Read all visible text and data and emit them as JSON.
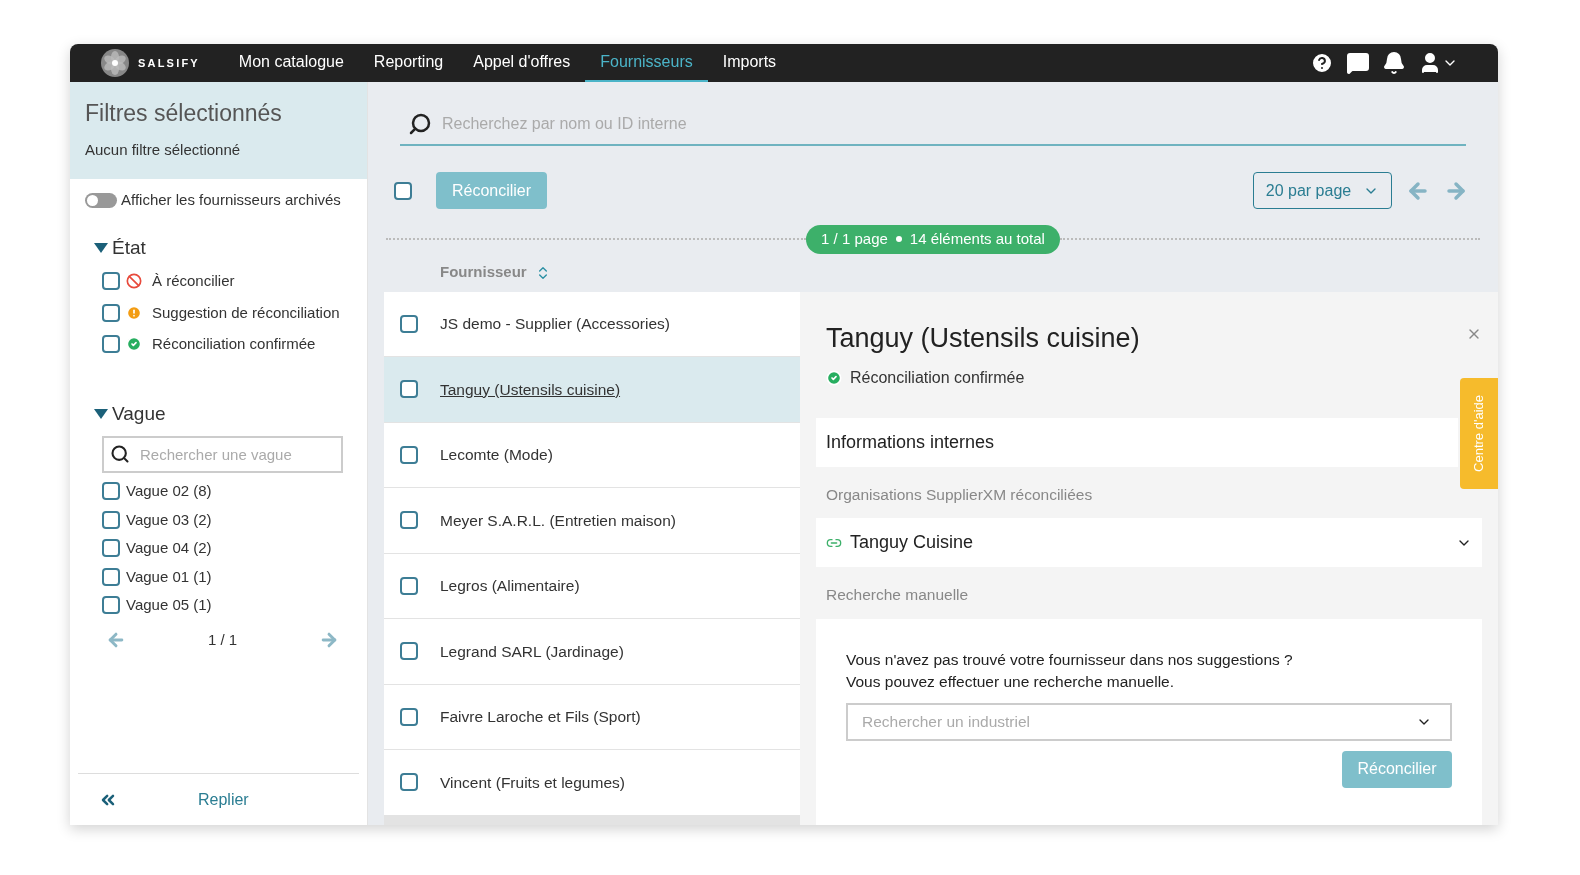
{
  "nav": {
    "logo": "SALSIFY",
    "items": [
      {
        "label": "Mon catalogue",
        "selected": false
      },
      {
        "label": "Reporting",
        "selected": false
      },
      {
        "label": "Appel d'offres",
        "selected": false
      },
      {
        "label": "Fournisseurs",
        "selected": true
      },
      {
        "label": "Imports",
        "selected": false
      }
    ]
  },
  "sidebar": {
    "title": "Filtres sélectionnés",
    "subtitle": "Aucun filtre sélectionné",
    "archived_toggle": {
      "label": "Afficher les fournisseurs archivés",
      "on": false
    },
    "etat": {
      "title": "État",
      "expanded": true,
      "items": [
        {
          "label": "À réconcilier",
          "checked": false,
          "kind": "blocked"
        },
        {
          "label": "Suggestion de réconciliation",
          "checked": false,
          "kind": "warning"
        },
        {
          "label": "Réconciliation confirmée",
          "checked": false,
          "kind": "confirmed"
        }
      ]
    },
    "vague": {
      "title": "Vague",
      "expanded": true,
      "search": {
        "placeholder": "Rechercher une vague"
      },
      "items": [
        {
          "label": "Vague 02 (8)",
          "checked": false
        },
        {
          "label": "Vague 03 (2)",
          "checked": false
        },
        {
          "label": "Vague 04 (2)",
          "checked": false
        },
        {
          "label": "Vague 01 (1)",
          "checked": false
        },
        {
          "label": "Vague 05 (1)",
          "checked": false
        }
      ],
      "pagination": "1 / 1"
    },
    "collapse": "Replier"
  },
  "main": {
    "search": {
      "placeholder": "Recherchez par nom ou ID interne"
    },
    "select_all": {
      "checked": false
    },
    "reconcile_button": {
      "label": "Réconcilier",
      "disabled": true
    },
    "per_page": "20 par page",
    "summary": {
      "pages": "1 / 1 page",
      "total": "14 éléments au total"
    },
    "column": "Fournisseur",
    "rows": [
      {
        "name": "JS demo - Supplier (Accessories)",
        "checked": false,
        "selected": false
      },
      {
        "name": "Tanguy (Ustensils cuisine)",
        "checked": false,
        "selected": true
      },
      {
        "name": "Lecomte (Mode)",
        "checked": false,
        "selected": false
      },
      {
        "name": "Meyer S.A.R.L. (Entretien maison)",
        "checked": false,
        "selected": false
      },
      {
        "name": "Legros (Alimentaire)",
        "checked": false,
        "selected": false
      },
      {
        "name": "Legrand SARL (Jardinage)",
        "checked": false,
        "selected": false
      },
      {
        "name": "Faivre Laroche et Fils (Sport)",
        "checked": false,
        "selected": false
      },
      {
        "name": "Vincent (Fruits et legumes)",
        "checked": false,
        "selected": false
      }
    ]
  },
  "detail": {
    "title": "Tanguy (Ustensils cuisine)",
    "status": {
      "label": "Réconciliation confirmée",
      "kind": "confirmed"
    },
    "internal_info": "Informations internes",
    "orgs_heading": "Organisations SupplierXM réconciliées",
    "orgs": [
      {
        "name": "Tanguy Cuisine"
      }
    ],
    "manual_heading": "Recherche manuelle",
    "manual_text": [
      "Vous n'avez pas trouvé votre fournisseur dans nos suggestions ?",
      "Vous pouvez effectuer une recherche manuelle."
    ],
    "manual_search": {
      "placeholder": "Rechercher un industriel"
    },
    "reconcile_button": {
      "label": "Réconcilier",
      "disabled": true
    }
  },
  "help_tab": "Centre d'aide"
}
